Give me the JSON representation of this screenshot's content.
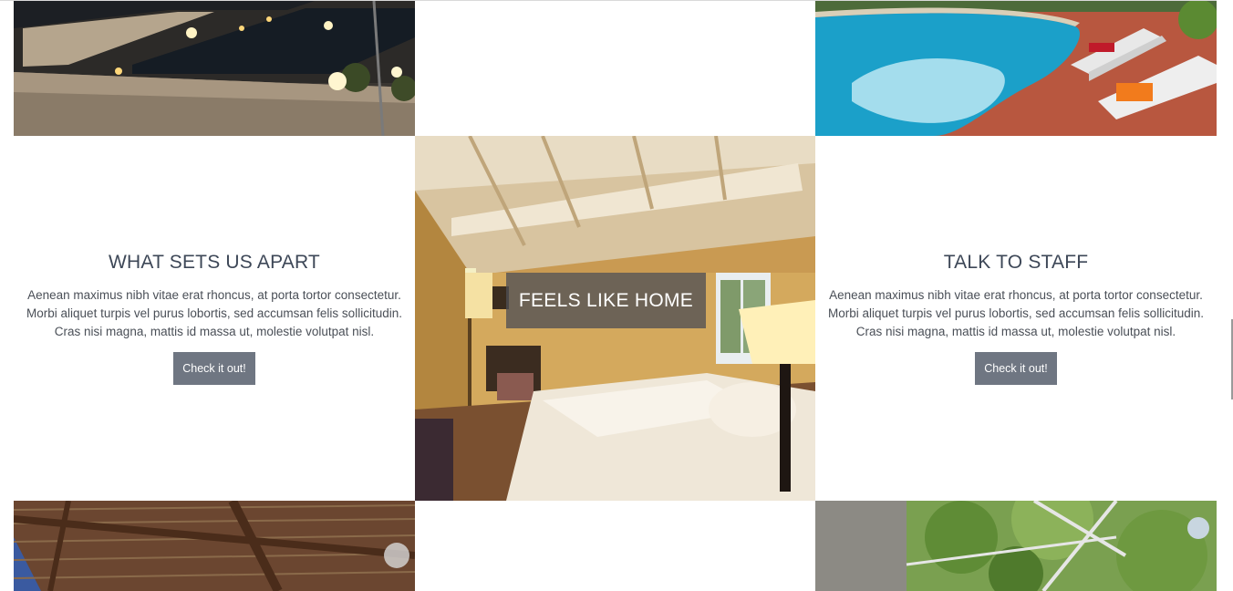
{
  "sections": {
    "left": {
      "title": "WHAT SETS US APART",
      "body": "Aenean maximus nibh vitae erat rhoncus, at porta tortor consectetur. Morbi aliquet turpis vel purus lobortis, sed accumsan felis sollicitudin. Cras nisi magna, mattis id massa ut, molestie volutpat nisl.",
      "button": "Check it out!"
    },
    "center": {
      "overlay_label": "FEELS LIKE HOME"
    },
    "right": {
      "title": "TALK TO STAFF",
      "body": "Aenean maximus nibh vitae erat rhoncus, at porta tortor consectetur. Morbi aliquet turpis vel purus lobortis, sed accumsan felis sollicitudin. Cras nisi magna, mattis id massa ut, molestie volutpat nisl.",
      "button": "Check it out!"
    }
  },
  "colors": {
    "heading": "#3d4757",
    "body_text": "#4a4f57",
    "button_bg": "#6f7682",
    "button_text": "#ffffff",
    "overlay_bg": "rgba(80,80,84,0.78)"
  },
  "images": {
    "top_left": "terrace-night-lights-photo",
    "top_right": "swimming-pool-loungers-photo",
    "center": "bedroom-photo",
    "bottom_left": "wooden-pergola-roof-photo",
    "bottom_right": "garden-pergola-trees-photo"
  }
}
